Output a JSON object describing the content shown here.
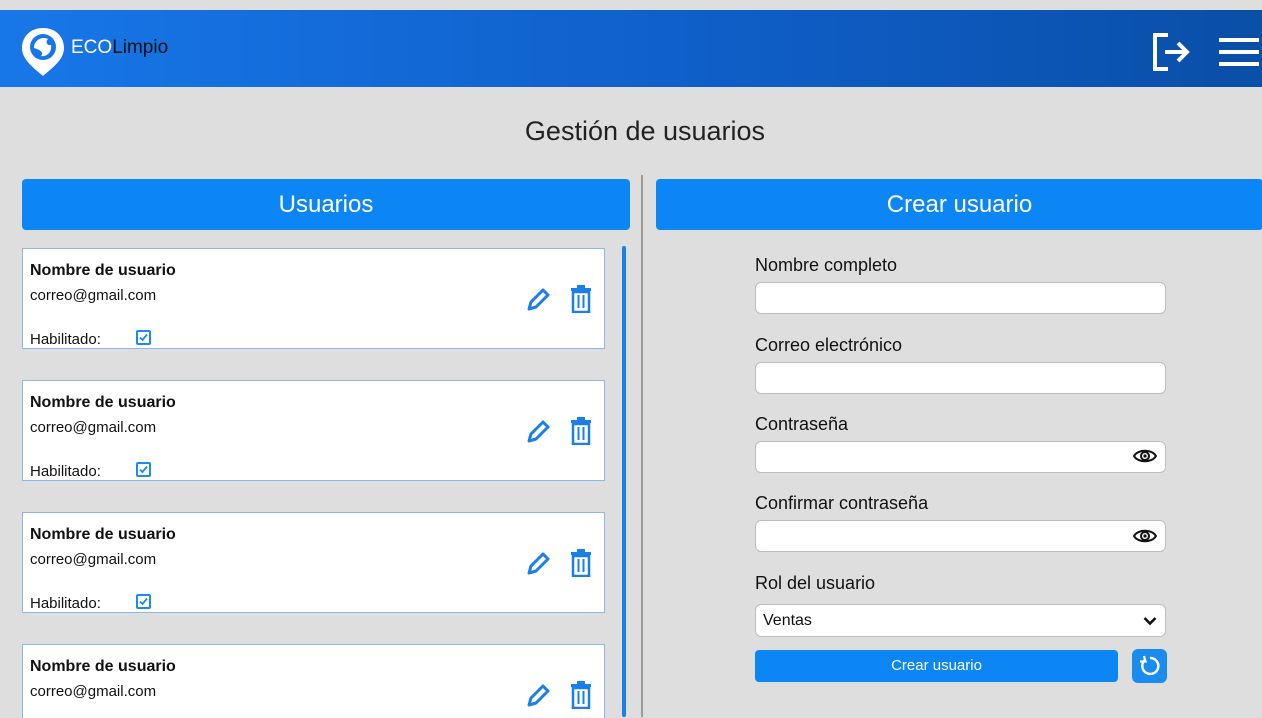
{
  "app": {
    "brand_part1": "ECO",
    "brand_part2": "Limpio"
  },
  "header": {
    "logout_icon": "logout-icon",
    "menu_icon": "hamburger-menu-icon"
  },
  "page": {
    "title": "Gestión de usuarios"
  },
  "users_panel": {
    "title": "Usuarios",
    "enabled_label": "Habilitado:",
    "users": [
      {
        "name": "Nombre de usuario",
        "email": "correo@gmail.com",
        "enabled": true
      },
      {
        "name": "Nombre de usuario",
        "email": "correo@gmail.com",
        "enabled": true
      },
      {
        "name": "Nombre de usuario",
        "email": "correo@gmail.com",
        "enabled": true
      },
      {
        "name": "Nombre de usuario",
        "email": "correo@gmail.com",
        "enabled": true
      }
    ]
  },
  "create_panel": {
    "title": "Crear usuario",
    "full_name_label": "Nombre completo",
    "full_name_value": "",
    "email_label": "Correo electrónico",
    "email_value": "",
    "password_label": "Contraseña",
    "password_value": "",
    "confirm_password_label": "Confirmar contraseña",
    "confirm_password_value": "",
    "role_label": "Rol del usuario",
    "role_selected": "Ventas",
    "submit_label": "Crear usuario"
  },
  "colors": {
    "accent": "#0d86f5",
    "header_gradient_start": "#1877e8",
    "header_gradient_end": "#0a4fa8",
    "background": "#dedede"
  }
}
